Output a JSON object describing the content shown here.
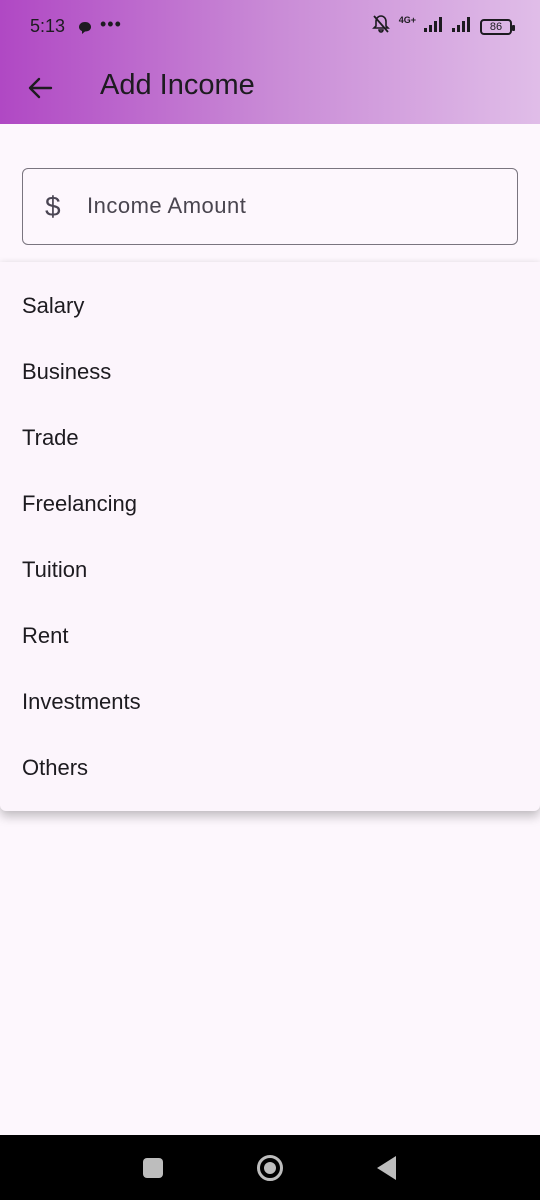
{
  "status_bar": {
    "time": "5:13",
    "more": "•••",
    "network": "4G+",
    "battery": "86"
  },
  "app_bar": {
    "title": "Add Income",
    "back_icon": "arrow-left-icon"
  },
  "amount_field": {
    "prefix": "$",
    "placeholder": "Income Amount",
    "value": ""
  },
  "category_menu": {
    "items": [
      "Salary",
      "Business",
      "Trade",
      "Freelancing",
      "Tuition",
      "Rent",
      "Investments",
      "Others"
    ]
  },
  "colors": {
    "gradient_start": "#b048c4",
    "gradient_end": "#e0bde8",
    "background": "#fdf7fd",
    "text": "#1d1b20"
  }
}
